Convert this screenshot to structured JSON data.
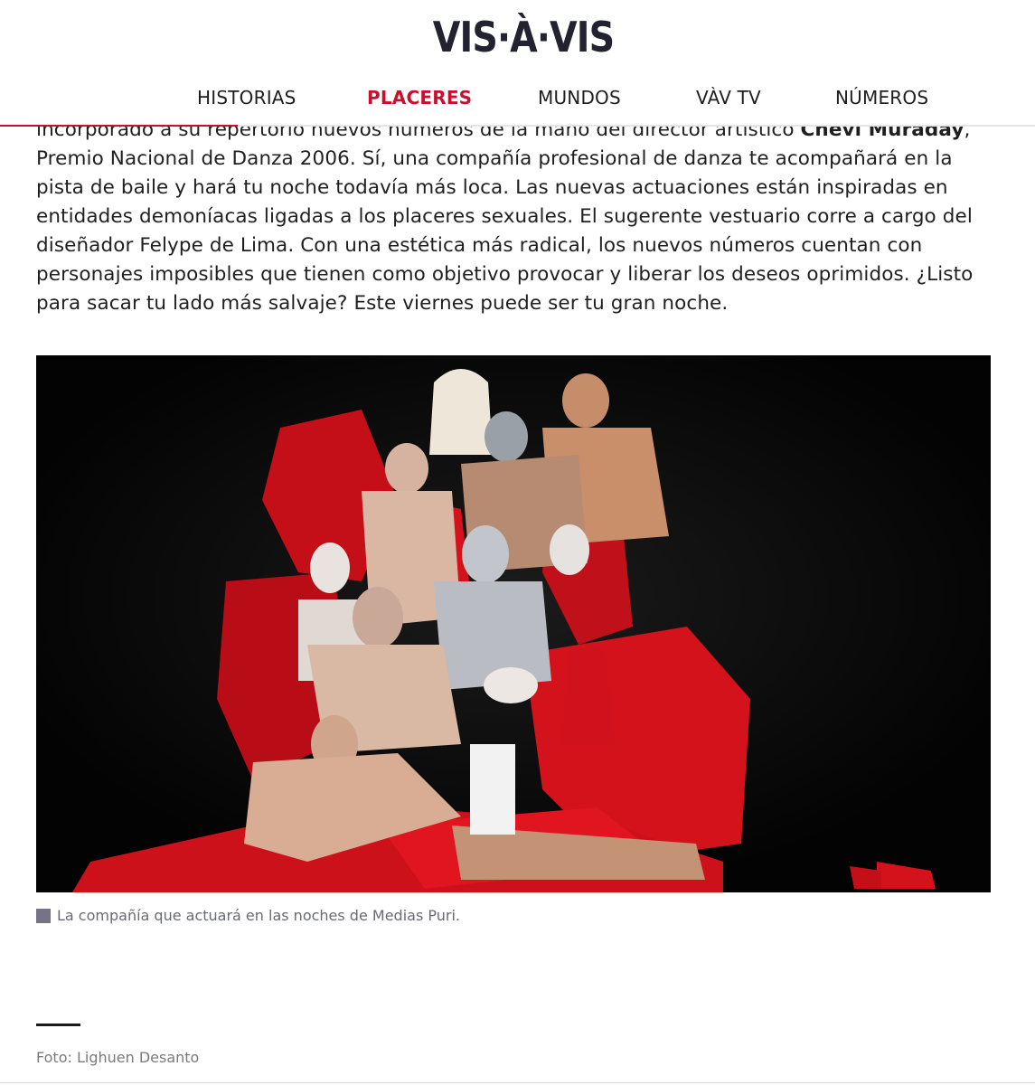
{
  "header": {
    "logo": "VIS·À·VIS",
    "nav": [
      {
        "label": "HISTORIAS",
        "active": false
      },
      {
        "label": "PLACERES",
        "active": true
      },
      {
        "label": "MUNDOS",
        "active": false
      },
      {
        "label": "VÀV TV",
        "active": false
      },
      {
        "label": "NÚMEROS",
        "active": false
      }
    ],
    "read_progress_percent": 23
  },
  "article": {
    "partial_line_start": "incorporado a su repertorio nuevos números de la mano del director artístico ",
    "partial_line_bold": "Chevi Muraday",
    "partial_line_end": ",",
    "paragraph": "Premio Nacional de Danza 2006. Sí, una compañía profesional de danza te acompañará en la pista de baile y hará tu noche todavía más loca. Las nuevas actuaciones están inspiradas en entidades demoníacas ligadas a los placeres sexuales. El sugerente vestuario corre a cargo del diseñador Felype de Lima. Con una estética más radical, los nuevos números cuentan con personajes imposibles que tienen como objetivo provocar y liberar los deseos oprimidos. ¿Listo para sacar tu lado más salvaje? Este viernes puede ser tu gran noche.",
    "image_caption": "La compañía que actuará en las noches de Medias Puri.",
    "photo_credit": "Foto: Lighuen Desanto"
  },
  "colors": {
    "accent": "#c8102e",
    "logo": "#222230",
    "photo_background": "#050505",
    "costume_red": "#d3121c",
    "caption_square": "#777386"
  }
}
